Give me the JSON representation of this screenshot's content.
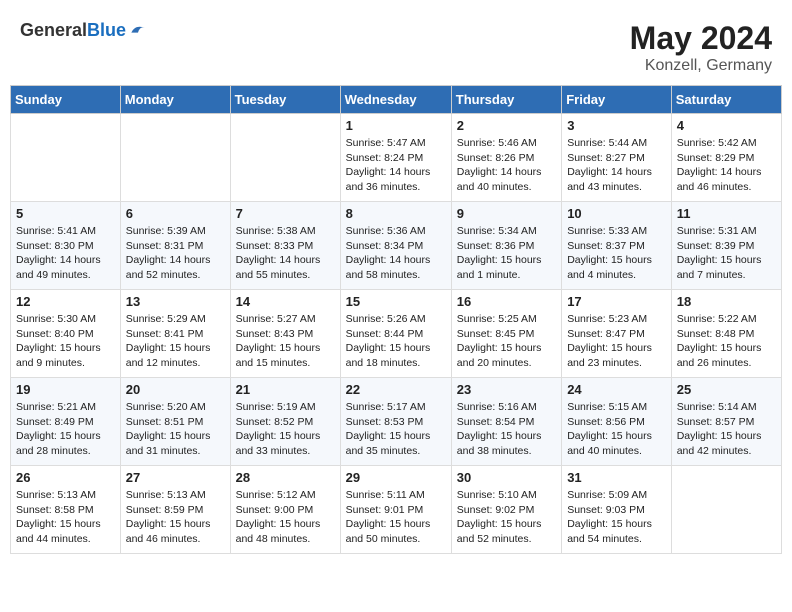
{
  "header": {
    "logo_general": "General",
    "logo_blue": "Blue",
    "month_year": "May 2024",
    "location": "Konzell, Germany"
  },
  "weekdays": [
    "Sunday",
    "Monday",
    "Tuesday",
    "Wednesday",
    "Thursday",
    "Friday",
    "Saturday"
  ],
  "weeks": [
    [
      {
        "day": "",
        "info": ""
      },
      {
        "day": "",
        "info": ""
      },
      {
        "day": "",
        "info": ""
      },
      {
        "day": "1",
        "info": "Sunrise: 5:47 AM\nSunset: 8:24 PM\nDaylight: 14 hours\nand 36 minutes."
      },
      {
        "day": "2",
        "info": "Sunrise: 5:46 AM\nSunset: 8:26 PM\nDaylight: 14 hours\nand 40 minutes."
      },
      {
        "day": "3",
        "info": "Sunrise: 5:44 AM\nSunset: 8:27 PM\nDaylight: 14 hours\nand 43 minutes."
      },
      {
        "day": "4",
        "info": "Sunrise: 5:42 AM\nSunset: 8:29 PM\nDaylight: 14 hours\nand 46 minutes."
      }
    ],
    [
      {
        "day": "5",
        "info": "Sunrise: 5:41 AM\nSunset: 8:30 PM\nDaylight: 14 hours\nand 49 minutes."
      },
      {
        "day": "6",
        "info": "Sunrise: 5:39 AM\nSunset: 8:31 PM\nDaylight: 14 hours\nand 52 minutes."
      },
      {
        "day": "7",
        "info": "Sunrise: 5:38 AM\nSunset: 8:33 PM\nDaylight: 14 hours\nand 55 minutes."
      },
      {
        "day": "8",
        "info": "Sunrise: 5:36 AM\nSunset: 8:34 PM\nDaylight: 14 hours\nand 58 minutes."
      },
      {
        "day": "9",
        "info": "Sunrise: 5:34 AM\nSunset: 8:36 PM\nDaylight: 15 hours\nand 1 minute."
      },
      {
        "day": "10",
        "info": "Sunrise: 5:33 AM\nSunset: 8:37 PM\nDaylight: 15 hours\nand 4 minutes."
      },
      {
        "day": "11",
        "info": "Sunrise: 5:31 AM\nSunset: 8:39 PM\nDaylight: 15 hours\nand 7 minutes."
      }
    ],
    [
      {
        "day": "12",
        "info": "Sunrise: 5:30 AM\nSunset: 8:40 PM\nDaylight: 15 hours\nand 9 minutes."
      },
      {
        "day": "13",
        "info": "Sunrise: 5:29 AM\nSunset: 8:41 PM\nDaylight: 15 hours\nand 12 minutes."
      },
      {
        "day": "14",
        "info": "Sunrise: 5:27 AM\nSunset: 8:43 PM\nDaylight: 15 hours\nand 15 minutes."
      },
      {
        "day": "15",
        "info": "Sunrise: 5:26 AM\nSunset: 8:44 PM\nDaylight: 15 hours\nand 18 minutes."
      },
      {
        "day": "16",
        "info": "Sunrise: 5:25 AM\nSunset: 8:45 PM\nDaylight: 15 hours\nand 20 minutes."
      },
      {
        "day": "17",
        "info": "Sunrise: 5:23 AM\nSunset: 8:47 PM\nDaylight: 15 hours\nand 23 minutes."
      },
      {
        "day": "18",
        "info": "Sunrise: 5:22 AM\nSunset: 8:48 PM\nDaylight: 15 hours\nand 26 minutes."
      }
    ],
    [
      {
        "day": "19",
        "info": "Sunrise: 5:21 AM\nSunset: 8:49 PM\nDaylight: 15 hours\nand 28 minutes."
      },
      {
        "day": "20",
        "info": "Sunrise: 5:20 AM\nSunset: 8:51 PM\nDaylight: 15 hours\nand 31 minutes."
      },
      {
        "day": "21",
        "info": "Sunrise: 5:19 AM\nSunset: 8:52 PM\nDaylight: 15 hours\nand 33 minutes."
      },
      {
        "day": "22",
        "info": "Sunrise: 5:17 AM\nSunset: 8:53 PM\nDaylight: 15 hours\nand 35 minutes."
      },
      {
        "day": "23",
        "info": "Sunrise: 5:16 AM\nSunset: 8:54 PM\nDaylight: 15 hours\nand 38 minutes."
      },
      {
        "day": "24",
        "info": "Sunrise: 5:15 AM\nSunset: 8:56 PM\nDaylight: 15 hours\nand 40 minutes."
      },
      {
        "day": "25",
        "info": "Sunrise: 5:14 AM\nSunset: 8:57 PM\nDaylight: 15 hours\nand 42 minutes."
      }
    ],
    [
      {
        "day": "26",
        "info": "Sunrise: 5:13 AM\nSunset: 8:58 PM\nDaylight: 15 hours\nand 44 minutes."
      },
      {
        "day": "27",
        "info": "Sunrise: 5:13 AM\nSunset: 8:59 PM\nDaylight: 15 hours\nand 46 minutes."
      },
      {
        "day": "28",
        "info": "Sunrise: 5:12 AM\nSunset: 9:00 PM\nDaylight: 15 hours\nand 48 minutes."
      },
      {
        "day": "29",
        "info": "Sunrise: 5:11 AM\nSunset: 9:01 PM\nDaylight: 15 hours\nand 50 minutes."
      },
      {
        "day": "30",
        "info": "Sunrise: 5:10 AM\nSunset: 9:02 PM\nDaylight: 15 hours\nand 52 minutes."
      },
      {
        "day": "31",
        "info": "Sunrise: 5:09 AM\nSunset: 9:03 PM\nDaylight: 15 hours\nand 54 minutes."
      },
      {
        "day": "",
        "info": ""
      }
    ]
  ]
}
